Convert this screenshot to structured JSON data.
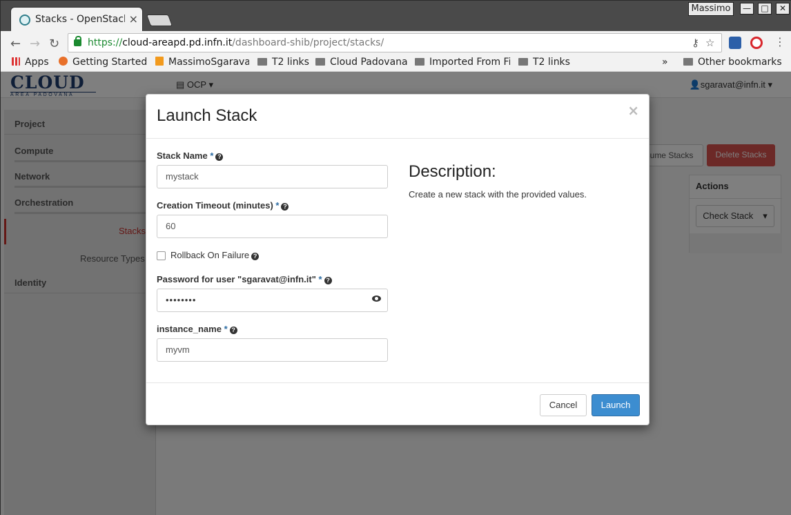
{
  "browser": {
    "tab_title": "Stacks - OpenStack",
    "tab_close": "×",
    "user_badge": "Massimo",
    "window_buttons": [
      "—",
      "□",
      "✕"
    ],
    "url_scheme": "https://",
    "url_host": "cloud-areapd.pd.infn.it",
    "url_path": "/dashboard-shib/project/stacks/",
    "bookmarks": [
      "Apps",
      "Getting Started",
      "MassimoSgarava",
      "T2 links",
      "Cloud Padovana",
      "Imported From Fi",
      "T2 links"
    ],
    "overflow": "»",
    "other_bookmarks": "Other bookmarks"
  },
  "header": {
    "logo_text": "CLOUD",
    "logo_sub": "AREA PADOVANA",
    "project": "OCP ▾",
    "user": "sgaravat@infn.it ▾"
  },
  "sidebar": {
    "items": [
      {
        "label": "Project"
      },
      {
        "label": "Compute"
      },
      {
        "label": "Network"
      },
      {
        "label": "Orchestration"
      },
      {
        "label": "Identity"
      }
    ],
    "subitems": [
      "Stacks",
      "Resource Types"
    ]
  },
  "background": {
    "resume_button": "sume Stacks",
    "delete_button": "Delete Stacks",
    "actions_header": "Actions",
    "check_stack": "Check Stack"
  },
  "modal": {
    "title": "Launch Stack",
    "close": "×",
    "fields": {
      "stack_name_label": "Stack Name",
      "stack_name_value": "mystack",
      "timeout_label": "Creation Timeout (minutes)",
      "timeout_value": "60",
      "rollback_label": "Rollback On Failure",
      "password_label": "Password for user \"sgaravat@infn.it\"",
      "password_value": "••••••••",
      "instance_label": "instance_name",
      "instance_value": "myvm"
    },
    "required_mark": "*",
    "help_glyph": "?",
    "description_title": "Description:",
    "description_text": "Create a new stack with the provided values.",
    "cancel": "Cancel",
    "launch": "Launch"
  }
}
